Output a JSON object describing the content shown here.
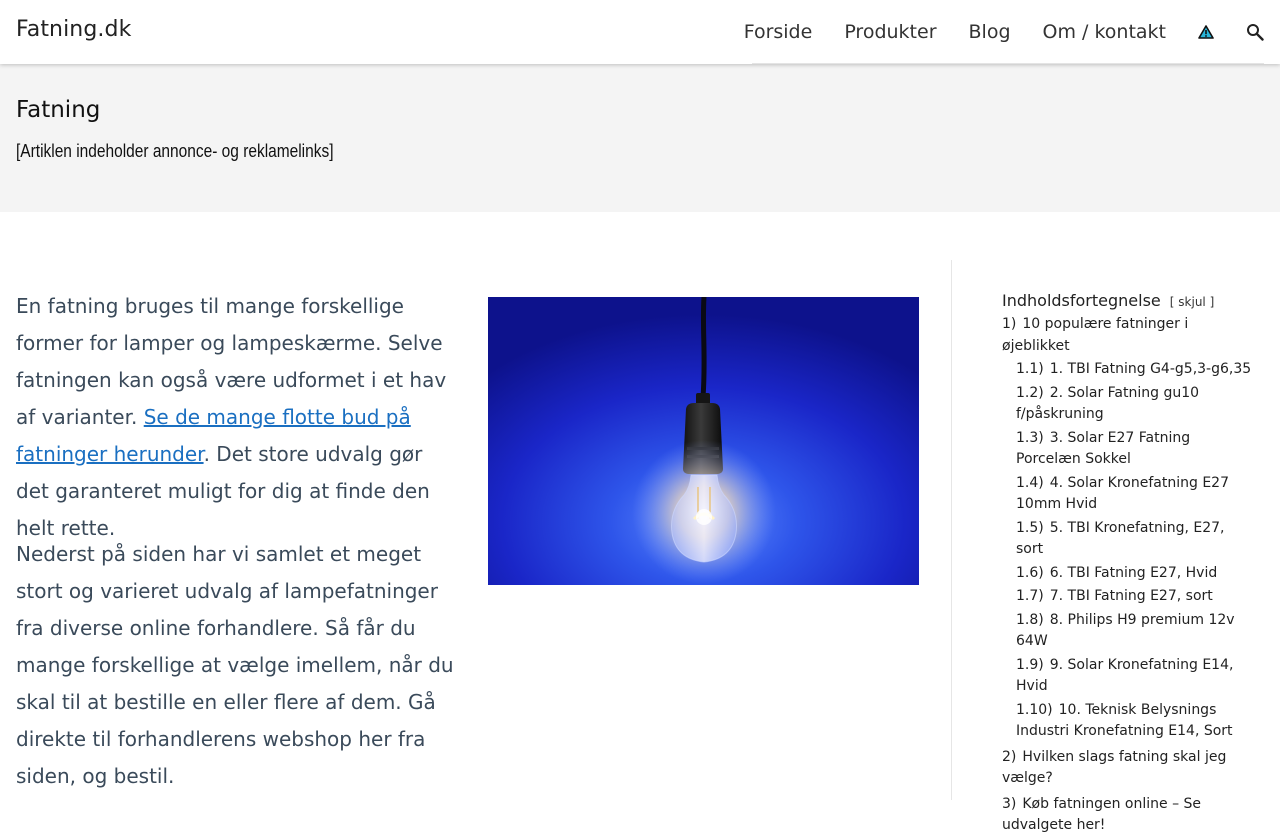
{
  "header": {
    "site_title": "Fatning.dk",
    "nav": [
      "Forside",
      "Produkter",
      "Blog",
      "Om / kontakt"
    ],
    "icons": [
      "warning-triangle-icon",
      "search-icon"
    ]
  },
  "band": {
    "title": "Fatning",
    "disclaimer": "[Artiklen indeholder annonce- og reklamelinks]"
  },
  "article": {
    "intro_before_link": "En fatning bruges til mange forskellige former for lamper og lampeskærme. Selve fatningen kan også være udformet i et hav af varianter.",
    "intro_link": "Se de mange flotte bud på fatninger herunder",
    "intro_after_link": ". Det store udvalg gør det garanteret muligt for dig at finde den helt rette.",
    "paragraph2": "Nederst på siden har vi samlet et meget stort og varieret udvalg af lampefatninger fra diverse online forhandlere. Så får du mange forskellige at vælge imellem, når du skal til at bestille en eller flere af dem. Gå direkte til forhandlerens webshop her fra siden, og bestil."
  },
  "toc": {
    "title": "Indholdsfortegnelse",
    "toggle_open": "[",
    "toggle_label": "skjul",
    "toggle_close": "]",
    "items": [
      {
        "num": "1)",
        "label": "10 populære fatninger i øjeblikket",
        "level": 1
      },
      {
        "num": "1.1)",
        "label": "1. TBI Fatning G4-g5,3-g6,35",
        "level": 2
      },
      {
        "num": "1.2)",
        "label": "2. Solar Fatning gu10 f/påskruning",
        "level": 2
      },
      {
        "num": "1.3)",
        "label": "3. Solar E27 Fatning Porcelæn Sokkel",
        "level": 2
      },
      {
        "num": "1.4)",
        "label": "4. Solar Kronefatning E27 10mm Hvid",
        "level": 2
      },
      {
        "num": "1.5)",
        "label": "5. TBI Kronefatning, E27, sort",
        "level": 2
      },
      {
        "num": "1.6)",
        "label": "6. TBI Fatning E27, Hvid",
        "level": 2
      },
      {
        "num": "1.7)",
        "label": "7. TBI Fatning E27, sort",
        "level": 2
      },
      {
        "num": "1.8)",
        "label": "8. Philips H9 premium 12v 64W",
        "level": 2
      },
      {
        "num": "1.9)",
        "label": "9. Solar Kronefatning E14, Hvid",
        "level": 2
      },
      {
        "num": "1.10)",
        "label": "10. Teknisk Belysnings Industri Kronefatning E14, Sort",
        "level": 2
      },
      {
        "num": "2)",
        "label": "Hvilken slags fatning skal jeg vælge?",
        "level": 1
      },
      {
        "num": "3)",
        "label": "Køb fatningen online – Se udvalgete her!",
        "level": 1
      }
    ]
  },
  "colors": {
    "link": "#1a6fc1",
    "body_text": "#3a4a5a",
    "band_bg": "#f4f4f4",
    "image_blue": "#1f2fd6"
  }
}
